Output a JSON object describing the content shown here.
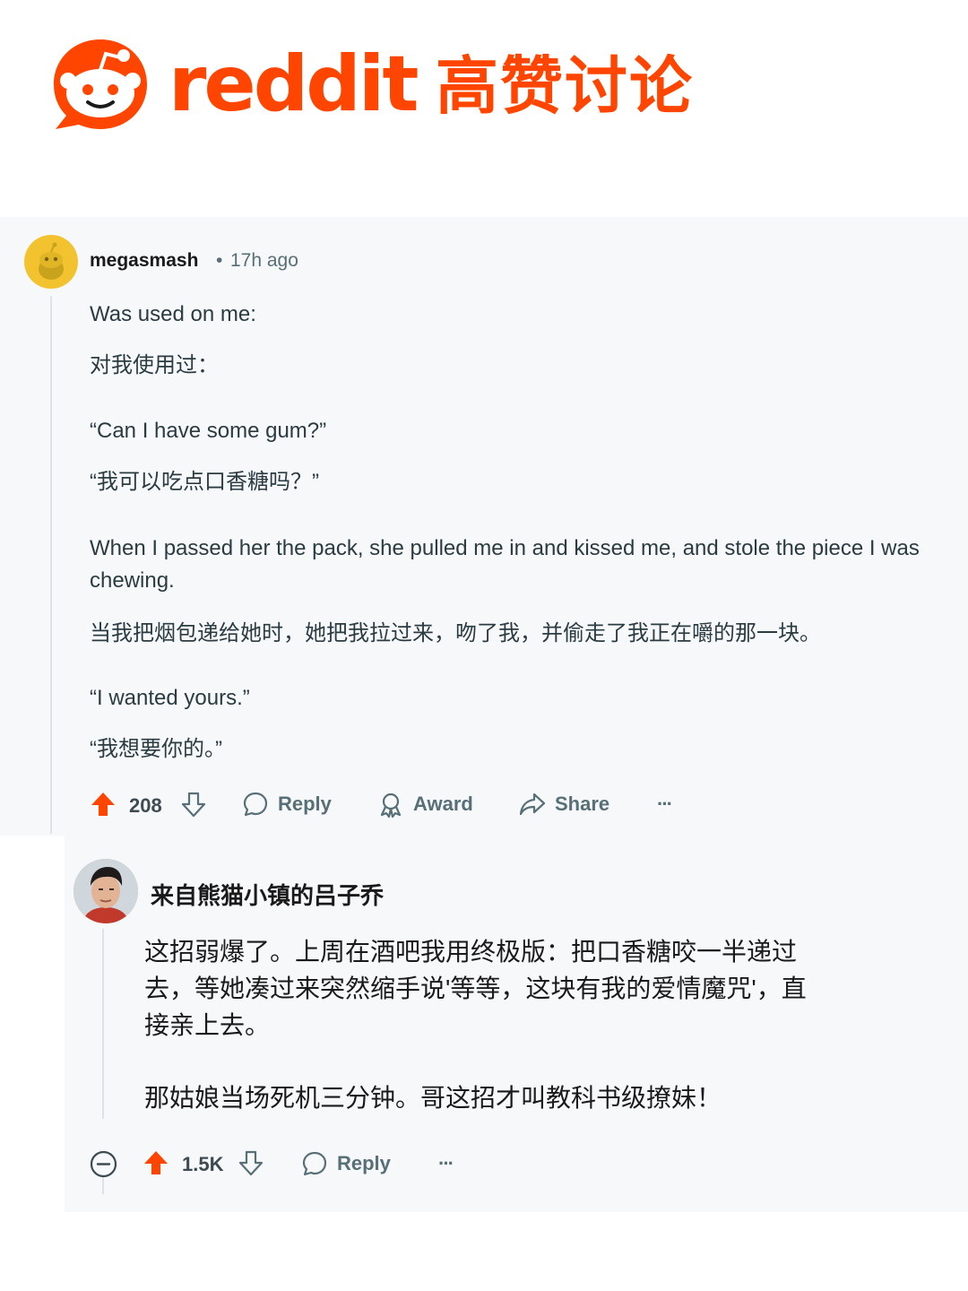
{
  "header": {
    "wordmark": "reddit",
    "title": "高赞讨论",
    "brand_color": "#ff4500"
  },
  "comment": {
    "username": "megasmash",
    "separator": "•",
    "time": "17h ago",
    "lines": [
      "Was used on me:",
      "对我使用过：",
      "“Can I have some gum?”",
      "“我可以吃点口香糖吗？”",
      "When I passed her the pack, she pulled me in and kissed me, and stole the piece I was chewing.",
      "当我把烟包递给她时，她把我拉过来，吻了我，并偷走了我正在嚼的那一块。",
      "“I wanted yours.”",
      "“我想要你的。”"
    ],
    "actions": {
      "upvotes": "208",
      "reply": "Reply",
      "award": "Award",
      "share": "Share",
      "more": "···"
    }
  },
  "reply": {
    "username": "来自熊猫小镇的吕子乔",
    "lines": [
      "这招弱爆了。上周在酒吧我用终极版：把口香糖咬一半递过",
      "去，等她凑过来突然缩手说'等等，这块有我的爱情魔咒'，直",
      "接亲上去。",
      "那姑娘当场死机三分钟。哥这招才叫教科书级撩妹！"
    ],
    "actions": {
      "upvotes": "1.5K",
      "reply": "Reply",
      "more": "···"
    }
  },
  "icons": {
    "logo": "reddit-snoo-logo",
    "upvote": "upvote-arrow-icon",
    "downvote": "downvote-arrow-icon",
    "reply": "speech-bubble-icon",
    "award": "award-ribbon-icon",
    "share": "share-arrow-icon",
    "more": "more-dots-icon",
    "collapse": "collapse-minus-icon"
  },
  "colors": {
    "upvote_active": "#ff4500",
    "meta_gray": "#576f76",
    "panel_bg": "#f7f8fa"
  }
}
